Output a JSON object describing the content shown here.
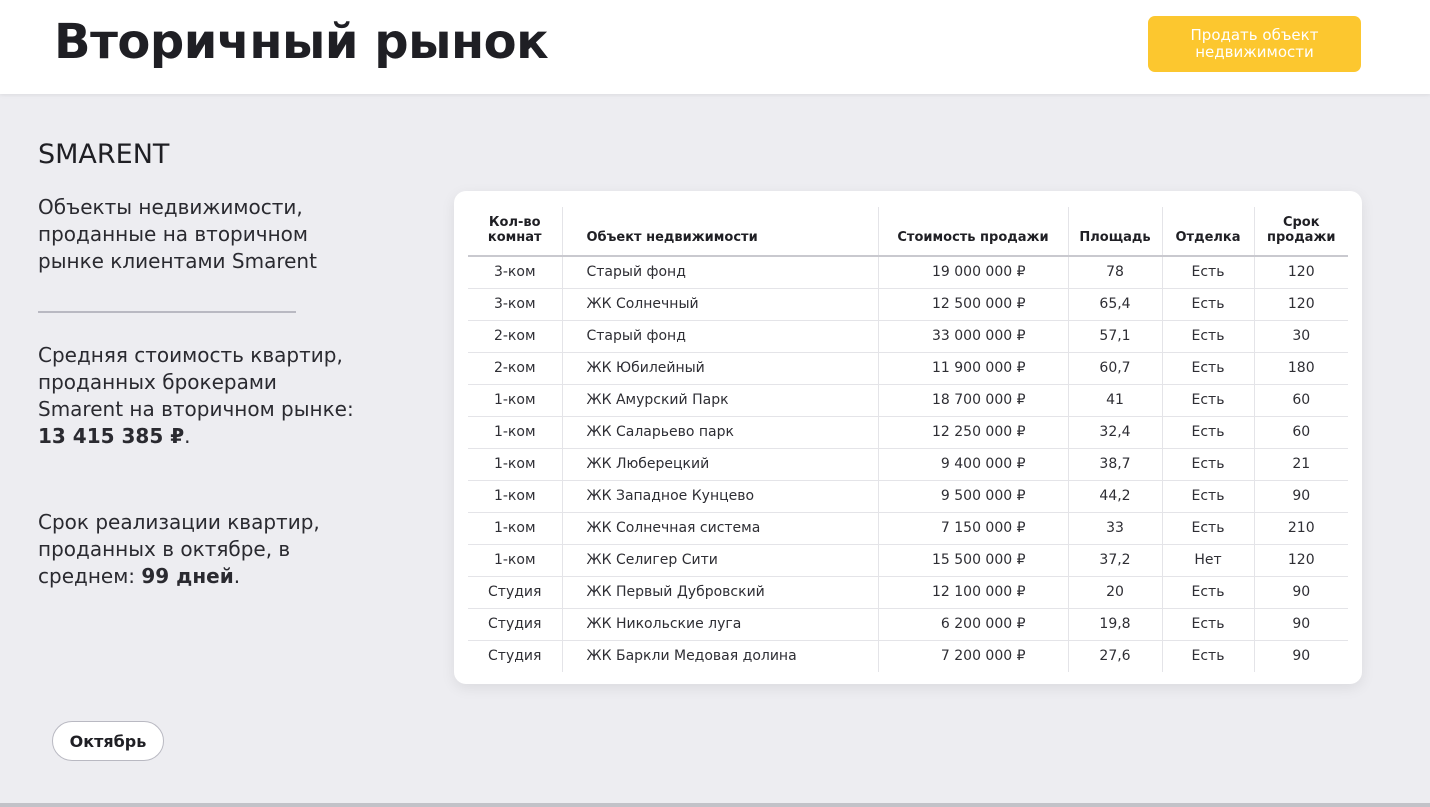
{
  "header": {
    "title": "Вторичный рынок",
    "sell_button": "Продать объект недвижимости"
  },
  "sidebar": {
    "brand": "SMARENT",
    "intro": "Объекты недвижимости, проданные на вторичном рынке клиентами Smarent",
    "avg_text": "Средняя стоимость квартир, проданных брокерами Smarent на вторичном рынке:",
    "avg_value": "13 415 385 ₽",
    "term_text": "Срок реализации квартир, проданных в октябре, в среднем:",
    "term_value": "99 дней"
  },
  "table": {
    "columns": [
      "Кол-во комнат",
      "Объект недвижимости",
      "Стоимость продажи",
      "Площадь",
      "Отделка",
      "Срок продажи"
    ],
    "rows": [
      [
        "3-ком",
        "Старый фонд",
        "19 000 000 ₽",
        "78",
        "Есть",
        "120"
      ],
      [
        "3-ком",
        "ЖК Солнечный",
        "12 500 000 ₽",
        "65,4",
        "Есть",
        "120"
      ],
      [
        "2-ком",
        "Старый фонд",
        "33 000 000 ₽",
        "57,1",
        "Есть",
        "30"
      ],
      [
        "2-ком",
        "ЖК Юбилейный",
        "11 900 000 ₽",
        "60,7",
        "Есть",
        "180"
      ],
      [
        "1-ком",
        "ЖК Амурский Парк",
        "18 700 000 ₽",
        "41",
        "Есть",
        "60"
      ],
      [
        "1-ком",
        "ЖК Саларьево парк",
        "12 250 000 ₽",
        "32,4",
        "Есть",
        "60"
      ],
      [
        "1-ком",
        "ЖК Люберецкий",
        "9 400 000 ₽",
        "38,7",
        "Есть",
        "21"
      ],
      [
        "1-ком",
        "ЖК Западное Кунцево",
        "9 500 000 ₽",
        "44,2",
        "Есть",
        "90"
      ],
      [
        "1-ком",
        "ЖК Солнечная система",
        "7 150 000 ₽",
        "33",
        "Есть",
        "210"
      ],
      [
        "1-ком",
        "ЖК Селигер Сити",
        "15 500 000 ₽",
        "37,2",
        "Нет",
        "120"
      ],
      [
        "Студия",
        "ЖК Первый Дубровский",
        "12 100 000 ₽",
        "20",
        "Есть",
        "90"
      ],
      [
        "Студия",
        "ЖК Никольские луга",
        "6 200 000 ₽",
        "19,8",
        "Есть",
        "90"
      ],
      [
        "Студия",
        "ЖК Баркли Медовая долина",
        "7 200 000 ₽",
        "27,6",
        "Есть",
        "90"
      ]
    ]
  },
  "footer": {
    "month_button": "Октябрь"
  },
  "colors": {
    "accent": "#fcc72f",
    "background": "#ededf1"
  }
}
